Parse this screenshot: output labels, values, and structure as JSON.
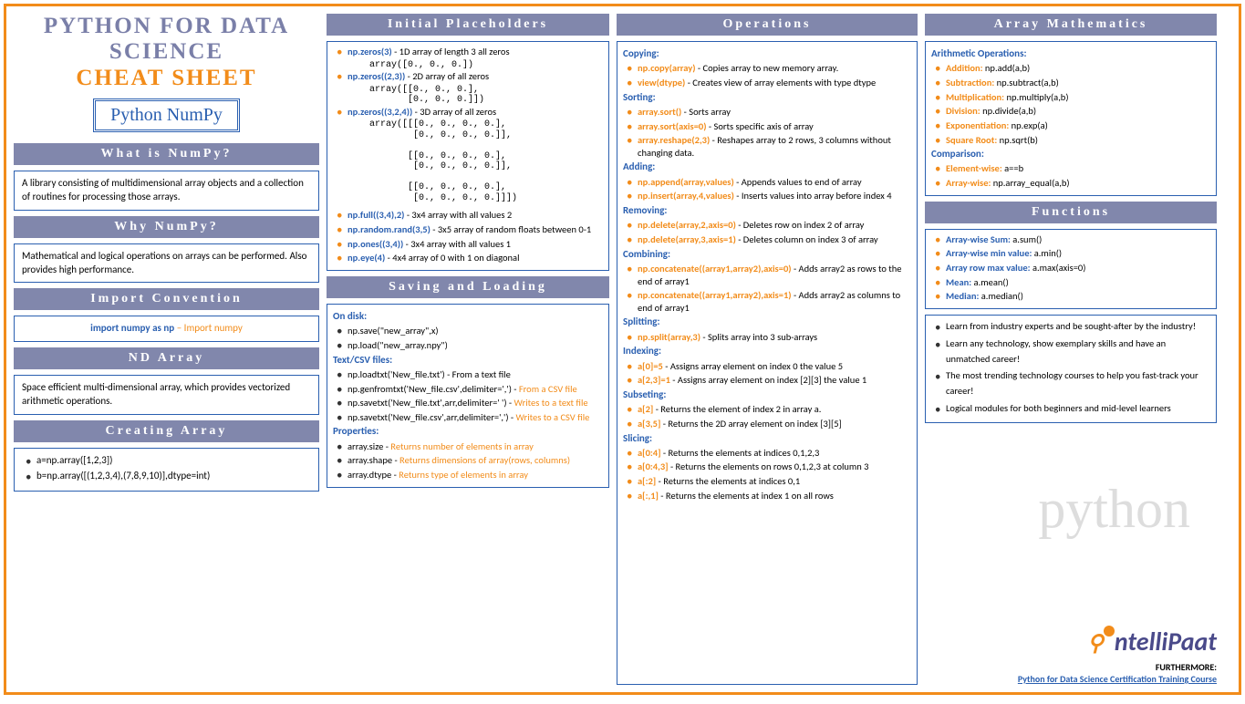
{
  "header": {
    "title_line1": "PYTHON FOR DATA SCIENCE",
    "title_line2": "CHEAT SHEET",
    "subtitle": "Python NumPy"
  },
  "col1": {
    "what_hdr": "What is NumPy?",
    "what_body": "A library consisting of multidimensional array objects and a collection of routines for processing those arrays.",
    "why_hdr": "Why NumPy?",
    "why_body": "Mathematical and logical operations on arrays can be performed. Also provides high performance.",
    "import_hdr": "Import Convention",
    "import_code": "import numpy as np",
    "import_note": " – Import numpy",
    "nd_hdr": "ND Array",
    "nd_body": "Space efficient multi-dimensional array, which provides vectorized arithmetic operations.",
    "create_hdr": "Creating Array",
    "create_a": "a=np.array([1,2,3])",
    "create_b": "b=np.array([(1,2,3,4),(7,8,9,10)],dtype=int)"
  },
  "col2": {
    "init_hdr": "Initial Placeholders",
    "z1_code": "np.zeros(3)",
    "z1_desc": " - 1D array of length 3 all zeros",
    "z1_out": "array([0., 0., 0.])",
    "z2_code": "np.zeros((2,3))",
    "z2_desc": " - 2D array of all zeros",
    "z2_out": "array([[0., 0., 0.],\n       [0., 0., 0.]])",
    "z3_code": "np.zeros((3,2,4))",
    "z3_desc": " - 3D array of all zeros",
    "z3_out": "array([[[0., 0., 0., 0.],\n        [0., 0., 0., 0.]],\n\n       [[0., 0., 0., 0.],\n        [0., 0., 0., 0.]],\n\n       [[0., 0., 0., 0.],\n        [0., 0., 0., 0.]]])",
    "full_code": "np.full((3,4),2)",
    "full_desc": " - 3x4 array with all values 2",
    "rand_code": "np.random.rand(3,5)",
    "rand_desc": " - 3x5 array of random floats between 0-1",
    "ones_code": "np.ones((3,4))",
    "ones_desc": " - 3x4 array with all values 1",
    "eye_code": "np.eye(4)",
    "eye_desc": " - 4x4 array of 0 with 1 on diagonal",
    "save_hdr": "Saving and Loading",
    "disk_hdr": "On disk:",
    "save1": "np.save(\"new_array\",x)",
    "save2": "np.load(\"new_array.npy\")",
    "text_hdr": "Text/CSV files:",
    "t1": "np.loadtxt('New_file.txt') - From a text file",
    "t2a": "np.genfromtxt('New_file.csv',delimiter=',') - ",
    "t2b": "From a CSV file",
    "t3a": "np.savetxt('New_file.txt',arr,delimiter=' ') - ",
    "t3b": "Writes to a text file",
    "t4a": "np.savetxt('New_file.csv',arr,delimiter=',') - ",
    "t4b": "Writes to a CSV file",
    "prop_hdr": "Properties:",
    "p1a": "array.size - ",
    "p1b": "Returns number of elements in array",
    "p2a": "array.shape - ",
    "p2b": "Returns dimensions of array(rows, columns)",
    "p3a": "array.dtype - ",
    "p3b": "Returns type of elements in array"
  },
  "col3": {
    "ops_hdr": "Operations",
    "copy_hdr": "Copying:",
    "c1_code": "np.copy(array)",
    "c1_desc": " - Copies array to new memory array.",
    "c2_code": "view(dtype)",
    "c2_desc": " - Creates view of array elements with type dtype",
    "sort_hdr": "Sorting:",
    "s1_code": "array.sort()",
    "s1_desc": " - Sorts array",
    "s2_code": "array.sort(axis=0)",
    "s2_desc": " - Sorts specific axis of array",
    "s3_code": "array.reshape(2,3)",
    "s3_desc": " - Reshapes array to 2 rows, 3 columns without changing data.",
    "add_hdr": "Adding:",
    "a1_code": "np.append(array,values)",
    "a1_desc": " - Appends values to end of array",
    "a2_code": "np.insert(array,4,values)",
    "a2_desc": " - Inserts values into array before index 4",
    "rem_hdr": "Removing:",
    "r1_code": "np.delete(array,2,axis=0)",
    "r1_desc": " - Deletes row on index 2 of array",
    "r2_code": "np.delete(array,3,axis=1)",
    "r2_desc": " - Deletes column on index 3 of array",
    "comb_hdr": "Combining:",
    "cb1_code": "np.concatenate((array1,array2),axis=0)",
    "cb1_desc": " - Adds array2 as rows to the end of array1",
    "cb2_code": "np.concatenate((array1,array2),axis=1)",
    "cb2_desc": " - Adds array2 as columns to end of array1",
    "split_hdr": "Splitting:",
    "sp1_code": "np.split(array,3)",
    "sp1_desc": " - Splits array into 3 sub-arrays",
    "idx_hdr": "Indexing:",
    "i1_code": "a[0]=5",
    "i1_desc": " - Assigns array element on index 0 the value 5",
    "i2_code": "a[2,3]=1",
    "i2_desc": " - Assigns array element on index [2][3] the value 1",
    "sub_hdr": "Subseting:",
    "su1_code": "a[2]",
    "su1_desc": " - Returns the element of index 2 in array a.",
    "su2_code": "a[3,5]",
    "su2_desc": " - Returns the 2D array element on index [3][5]",
    "slice_hdr": "Slicing:",
    "sl1_code": "a[0:4]",
    "sl1_desc": " - Returns the elements at indices 0,1,2,3",
    "sl2_code": "a[0:4,3]",
    "sl2_desc": " - Returns the elements on rows 0,1,2,3 at column 3",
    "sl3_code": "a[:2]",
    "sl3_desc": " - Returns the elements at indices 0,1",
    "sl4_code": "a[:,1]",
    "sl4_desc": " - Returns the elements at index 1 on all rows"
  },
  "col4": {
    "math_hdr": "Array Mathematics",
    "arith_hdr": "Arithmetic Operations:",
    "m1_lbl": "Addition:",
    "m1_val": " np.add(a,b)",
    "m2_lbl": "Subtraction:",
    "m2_val": " np.subtract(a,b)",
    "m3_lbl": "Multiplication:",
    "m3_val": "  np.multiply(a,b)",
    "m4_lbl": "Division:",
    "m4_val": " np.divide(a,b)",
    "m5_lbl": "Exponentiation:",
    "m5_val": " np.exp(a)",
    "m6_lbl": "Square Root:",
    "m6_val": " np.sqrt(b)",
    "comp_hdr": "Comparison:",
    "cp1_lbl": "Element-wise:",
    "cp1_val": " a==b",
    "cp2_lbl": "Array-wise:",
    "cp2_val": " np.array_equal(a,b)",
    "fn_hdr": "Functions",
    "f1_lbl": "Array-wise Sum:",
    "f1_val": " a.sum()",
    "f2_lbl": "Array-wise min value:",
    "f2_val": " a.min()",
    "f3_lbl": "Array row max value:",
    "f3_val": "  a.max(axis=0)",
    "f4_lbl": "Mean:",
    "f4_val": " a.mean()",
    "f5_lbl": "Median:",
    "f5_val": " a.median()",
    "promo1": "Learn from industry experts and be sought-after by the industry!",
    "promo2": "Learn any technology, show exemplary skills and have an unmatched career!",
    "promo3": "The most trending technology courses to help you fast-track your career!",
    "promo4": "Logical modules for both beginners and mid-level learners",
    "logo_text": "ntelliPaat",
    "further_lbl": "FURTHERMORE:",
    "further_link": "Python for Data Science Certification Training Course"
  }
}
